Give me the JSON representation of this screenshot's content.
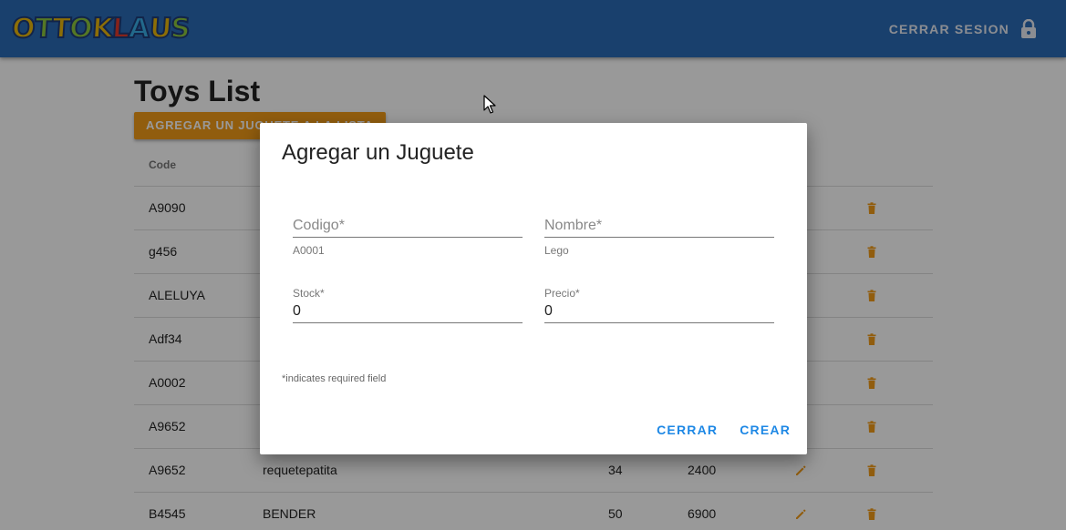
{
  "header": {
    "logo_letters": [
      {
        "char": "O",
        "color": "#e9b80c"
      },
      {
        "char": "T",
        "color": "#8cc63f"
      },
      {
        "char": "T",
        "color": "#e9b80c"
      },
      {
        "char": "O",
        "color": "#8cc63f"
      },
      {
        "char": "K",
        "color": "#e9b80c"
      },
      {
        "char": "L",
        "color": "#e03a2c"
      },
      {
        "char": "A",
        "color": "#3ab0e8"
      },
      {
        "char": "U",
        "color": "#e9b80c"
      },
      {
        "char": "S",
        "color": "#8cc63f"
      }
    ],
    "logout_label": "CERRAR SESION",
    "logout_icon": "lock-icon"
  },
  "page": {
    "title": "Toys List",
    "add_button_label": "AGREGAR UN JUGUETE A LA LISTA",
    "table": {
      "columns": [
        "Code",
        "",
        "",
        "",
        "",
        ""
      ],
      "rows": [
        {
          "code": "A9090",
          "name": "",
          "stock": "",
          "price": ""
        },
        {
          "code": "g456",
          "name": "",
          "stock": "",
          "price": ""
        },
        {
          "code": "ALELUYA",
          "name": "",
          "stock": "",
          "price": ""
        },
        {
          "code": "Adf34",
          "name": "",
          "stock": "",
          "price": ""
        },
        {
          "code": "A0002",
          "name": "",
          "stock": "",
          "price": ""
        },
        {
          "code": "A9652",
          "name": "",
          "stock": "",
          "price": ""
        },
        {
          "code": "A9652",
          "name": "requetepatita",
          "stock": "34",
          "price": "2400"
        },
        {
          "code": "B4545",
          "name": "BENDER",
          "stock": "50",
          "price": "6900"
        }
      ],
      "edit_icon": "pencil-icon",
      "delete_icon": "trash-icon"
    }
  },
  "modal": {
    "title": "Agregar un Juguete",
    "fields": {
      "codigo": {
        "placeholder": "Codigo*",
        "value": "",
        "helper": "A0001"
      },
      "nombre": {
        "placeholder": "Nombre*",
        "value": "",
        "helper": "Lego"
      },
      "stock": {
        "label": "Stock*",
        "value": "0"
      },
      "precio": {
        "label": "Precio*",
        "value": "0"
      }
    },
    "required_note": "*indicates required field",
    "cancel_label": "CERRAR",
    "submit_label": "CREAR"
  },
  "colors": {
    "appbar": "#2b6cb6",
    "accent": "#f29b18",
    "action_text": "#1e88e5"
  }
}
